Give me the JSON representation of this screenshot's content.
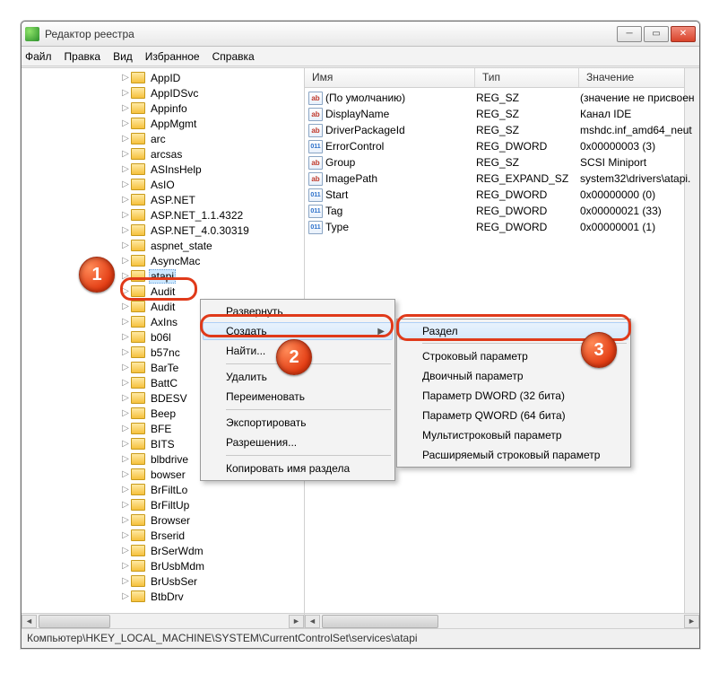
{
  "window": {
    "title": "Редактор реестра"
  },
  "menu": {
    "file": "Файл",
    "edit": "Правка",
    "view": "Вид",
    "favorites": "Избранное",
    "help": "Справка"
  },
  "tree": {
    "indent_base": 108,
    "items": [
      {
        "label": "AppID"
      },
      {
        "label": "AppIDSvc"
      },
      {
        "label": "Appinfo"
      },
      {
        "label": "AppMgmt"
      },
      {
        "label": "arc"
      },
      {
        "label": "arcsas"
      },
      {
        "label": "ASInsHelp"
      },
      {
        "label": "AsIO"
      },
      {
        "label": "ASP.NET"
      },
      {
        "label": "ASP.NET_1.1.4322"
      },
      {
        "label": "ASP.NET_4.0.30319"
      },
      {
        "label": "aspnet_state"
      },
      {
        "label": "AsyncMac"
      },
      {
        "label": "atapi",
        "selected": true
      },
      {
        "label": "Audit"
      },
      {
        "label": "Audit"
      },
      {
        "label": "AxIns"
      },
      {
        "label": "b06l"
      },
      {
        "label": "b57nc"
      },
      {
        "label": "BarTe"
      },
      {
        "label": "BattC"
      },
      {
        "label": "BDESV"
      },
      {
        "label": "Beep"
      },
      {
        "label": "BFE"
      },
      {
        "label": "BITS"
      },
      {
        "label": "blbdrive"
      },
      {
        "label": "bowser"
      },
      {
        "label": "BrFiltLo"
      },
      {
        "label": "BrFiltUp"
      },
      {
        "label": "Browser"
      },
      {
        "label": "Brserid"
      },
      {
        "label": "BrSerWdm"
      },
      {
        "label": "BrUsbMdm"
      },
      {
        "label": "BrUsbSer"
      },
      {
        "label": "BtbDrv"
      }
    ]
  },
  "list": {
    "columns": {
      "name": "Имя",
      "type": "Тип",
      "value": "Значение"
    },
    "rows": [
      {
        "icon": "ab",
        "name": "(По умолчанию)",
        "type": "REG_SZ",
        "value": "(значение не присвоен"
      },
      {
        "icon": "ab",
        "name": "DisplayName",
        "type": "REG_SZ",
        "value": "Канал IDE"
      },
      {
        "icon": "ab",
        "name": "DriverPackageId",
        "type": "REG_SZ",
        "value": "mshdc.inf_amd64_neut"
      },
      {
        "icon": "num",
        "name": "ErrorControl",
        "type": "REG_DWORD",
        "value": "0x00000003 (3)"
      },
      {
        "icon": "ab",
        "name": "Group",
        "type": "REG_SZ",
        "value": "SCSI Miniport"
      },
      {
        "icon": "ab",
        "name": "ImagePath",
        "type": "REG_EXPAND_SZ",
        "value": "system32\\drivers\\atapi."
      },
      {
        "icon": "num",
        "name": "Start",
        "type": "REG_DWORD",
        "value": "0x00000000 (0)"
      },
      {
        "icon": "num",
        "name": "Tag",
        "type": "REG_DWORD",
        "value": "0x00000021 (33)"
      },
      {
        "icon": "num",
        "name": "Type",
        "type": "REG_DWORD",
        "value": "0x00000001 (1)"
      }
    ]
  },
  "context_menu": {
    "expand": "Развернуть",
    "create": "Создать",
    "find": "Найти...",
    "delete": "Удалить",
    "rename": "Переименовать",
    "export": "Экспортировать",
    "permissions": "Разрешения...",
    "copy_key_name": "Копировать имя раздела"
  },
  "submenu": {
    "key": "Раздел",
    "string": "Строковый параметр",
    "binary": "Двоичный параметр",
    "dword": "Параметр DWORD (32 бита)",
    "qword": "Параметр QWORD (64 бита)",
    "multi_string": "Мультистроковый параметр",
    "expand_string": "Расширяемый строковый параметр"
  },
  "status": {
    "path": "Компьютер\\HKEY_LOCAL_MACHINE\\SYSTEM\\CurrentControlSet\\services\\atapi"
  },
  "badges": {
    "b1": "1",
    "b2": "2",
    "b3": "3"
  },
  "icons": {
    "ab": "ab",
    "num": "011"
  }
}
